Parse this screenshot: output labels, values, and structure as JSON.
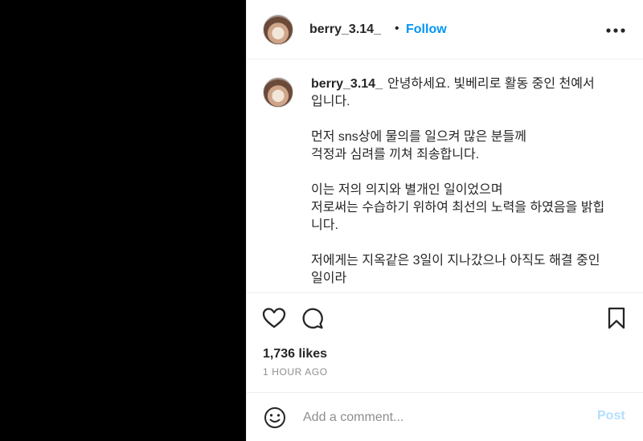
{
  "post": {
    "username": "berry_3.14_",
    "separator": "•",
    "follow_label": "Follow",
    "caption": "안녕하세요. 빛베리로 활동 중인 천예서\n입니다.\n\n먼저 sns상에 물의를 일으켜 많은 분들께\n걱정과 심려를 끼쳐 죄송합니다.\n\n이는 저의 의지와 별개인 일이었으며\n저로써는 수습하기 위하여 최선의 노력을 하였음을 밝힙\n니다.\n\n저에게는 지옥같은 3일이 지나갔으나 아직도 해결 중인\n일이라",
    "likes": "1,736 likes",
    "time": "1 HOUR AGO"
  },
  "icons": {
    "more": "more-options-icon",
    "like": "heart-icon",
    "comment": "comment-icon",
    "save": "bookmark-icon",
    "emoji": "emoji-icon"
  },
  "comment_box": {
    "placeholder": "Add a comment...",
    "post_label": "Post"
  },
  "colors": {
    "accent": "#0095f6",
    "post_disabled": "#b2dffc",
    "media_bg": "#000000",
    "muted": "#8e8e8e"
  }
}
